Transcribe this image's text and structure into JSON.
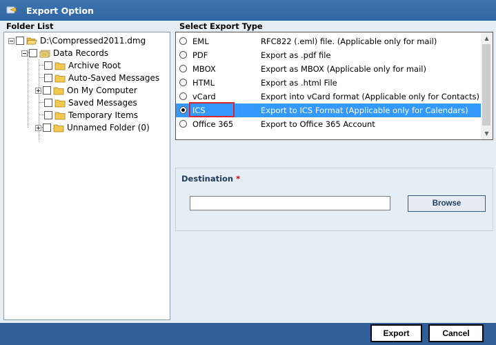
{
  "window": {
    "title": "Export Option",
    "icon": "app-icon"
  },
  "folder_list": {
    "label": "Folder List",
    "root": "D:\\Compressed2011.dmg",
    "data_records": "Data Records",
    "children": [
      "Archive Root",
      "Auto-Saved Messages",
      "On My Computer",
      "Saved Messages",
      "Temporary Items",
      "Unnamed Folder (0)"
    ]
  },
  "export_type": {
    "label": "Select Export Type",
    "options": [
      {
        "name": "EML",
        "desc": "RFC822 (.eml) file. (Applicable only for mail)"
      },
      {
        "name": "PDF",
        "desc": "Export as .pdf file"
      },
      {
        "name": "MBOX",
        "desc": "Export as MBOX (Applicable only for mail)"
      },
      {
        "name": "HTML",
        "desc": "Export as .html File"
      },
      {
        "name": "vCard",
        "desc": "Export into vCard format (Applicable only for Contacts)"
      },
      {
        "name": "ICS",
        "desc": "Export to ICS Format (Applicable only for Calendars)"
      },
      {
        "name": "Office 365",
        "desc": "Export to Office 365 Account"
      }
    ],
    "selected": "ICS"
  },
  "destination": {
    "label": "Destination",
    "required_mark": "*",
    "value": "",
    "browse_label": "Browse"
  },
  "footer": {
    "export_label": "Export",
    "cancel_label": "Cancel"
  },
  "colors": {
    "title_bar": "#2f66a3",
    "selection": "#3399ff",
    "footer": "#2f5f96",
    "highlight": "#d9262e"
  }
}
